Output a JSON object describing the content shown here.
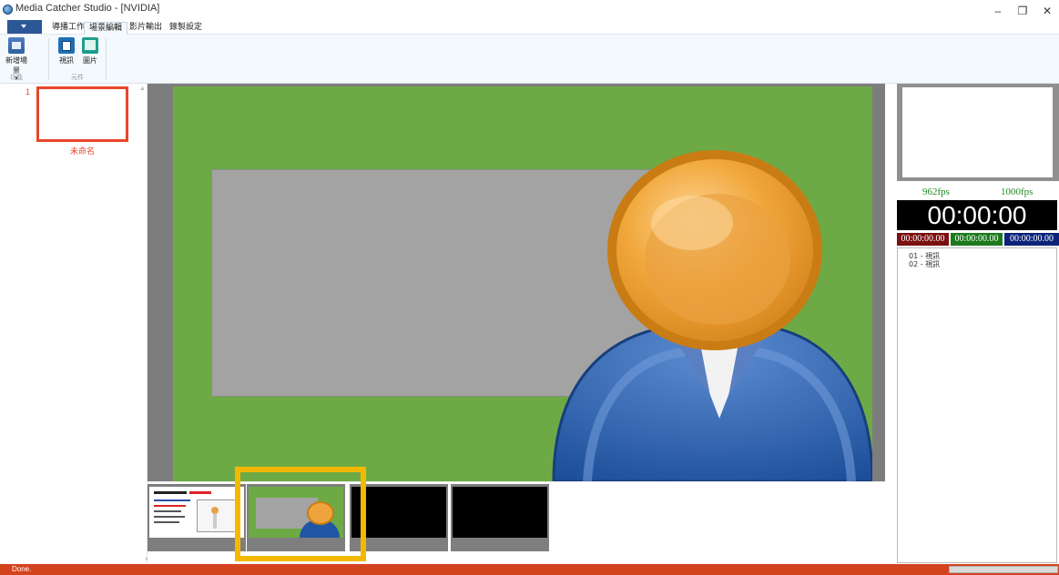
{
  "window": {
    "title": "Media Catcher Studio - [NVIDIA]",
    "minimize": "–",
    "restore": "❐",
    "close": "✕"
  },
  "ribbon": {
    "tabs": [
      {
        "label": "導播工作",
        "active": false
      },
      {
        "label": "場景編輯",
        "active": true
      },
      {
        "label": "影片輸出",
        "active": false
      },
      {
        "label": "錄製設定",
        "active": false
      }
    ],
    "buttons": {
      "new_scene": "新增場景",
      "new_scene_arrow": "▾",
      "video": "視訊",
      "image": "圖片"
    },
    "groups": {
      "function": "功能",
      "component": "元件"
    }
  },
  "scenes": [
    {
      "number": "1",
      "name": "未命名"
    }
  ],
  "right_panel": {
    "fps_left": "962fps",
    "fps_right": "1000fps",
    "timecode": "00:00:00",
    "timecode_red": "00:00:00.00",
    "timecode_green": "00:00:00.00",
    "timecode_blue": "00:00:00.00",
    "clips": [
      "01 - 視訊",
      "02 - 視訊"
    ]
  },
  "status": {
    "text": "Done."
  },
  "colors": {
    "accent": "#2b5797",
    "scene_highlight": "#e8462a",
    "canvas_green": "#6daa45",
    "selection": "#f5b800",
    "statusbar": "#d4421e"
  },
  "icons": [
    "app-icon",
    "new-scene-icon",
    "video-icon",
    "image-icon",
    "person-avatar-icon"
  ]
}
